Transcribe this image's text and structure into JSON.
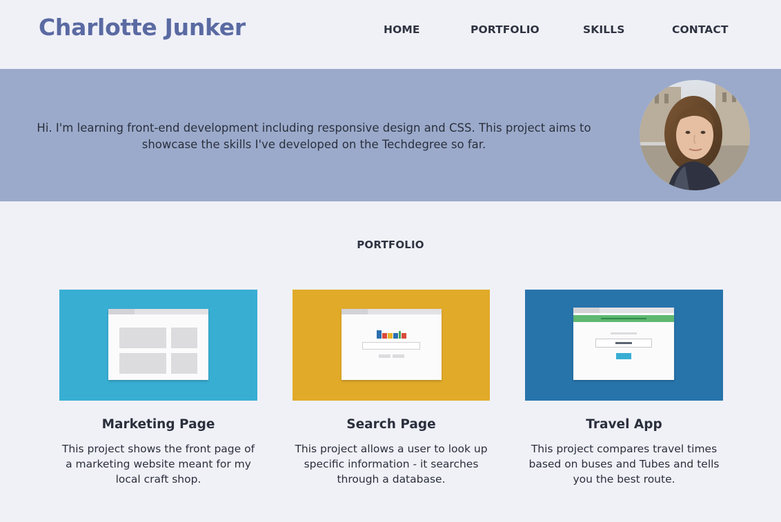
{
  "header": {
    "site_title": "Charlotte Junker",
    "nav": [
      "HOME",
      "PORTFOLIO",
      "SKILLS",
      "CONTACT"
    ]
  },
  "hero": {
    "intro": "Hi. I'm learning front-end development including responsive design and CSS. This project aims to showcase the skills I've developed on the Techdegree so far."
  },
  "portfolio": {
    "heading": "PORTFOLIO",
    "projects": [
      {
        "title": "Marketing Page",
        "description": "This project shows the front page of a marketing website meant for my local craft shop.",
        "thumb_color": "#38aed3"
      },
      {
        "title": "Search Page",
        "description": "This project allows a user to look up specific information - it searches through a database.",
        "thumb_color": "#e1aa29"
      },
      {
        "title": "Travel App",
        "description": "This project compares travel times based on buses and Tubes and tells you the best route.",
        "thumb_color": "#2774ab"
      }
    ]
  },
  "colors": {
    "page_bg": "#f0f1f7",
    "title_accent": "#5a6aa2",
    "hero_bg": "#9baacb",
    "text": "#2e3340"
  }
}
